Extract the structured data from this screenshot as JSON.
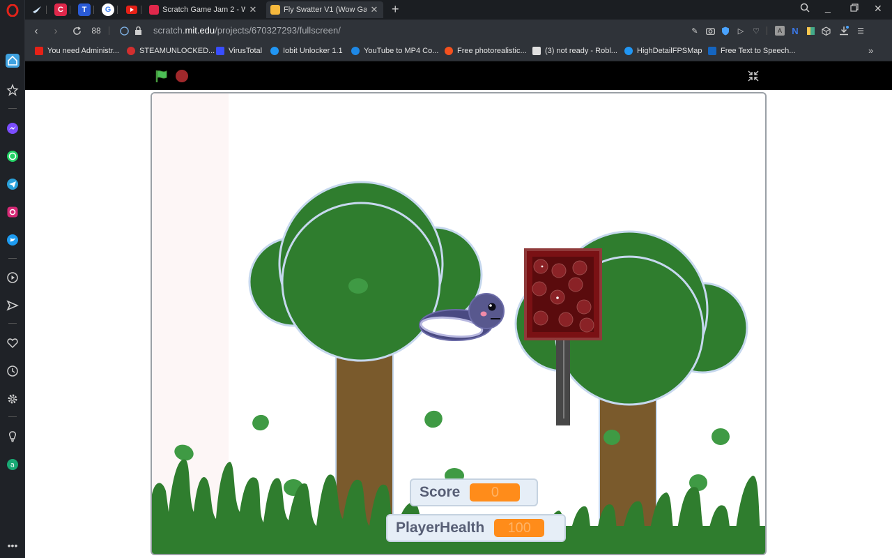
{
  "tabs": [
    {
      "title": "Scratch Game Jam 2 - Wow",
      "active": false
    },
    {
      "title": "Fly Swatter V1 (Wow Game",
      "active": true
    }
  ],
  "url": {
    "prefix": "scratch.",
    "domain": "mit.edu",
    "path": "/projects/670327293/fullscreen/"
  },
  "bookmarks": [
    {
      "label": "You need Administr...",
      "color": "#e62117"
    },
    {
      "label": "STEAMUNLOCKED...",
      "color": "#d32f2f"
    },
    {
      "label": "VirusTotal",
      "color": "#394eff"
    },
    {
      "label": "Iobit Unlocker 1.1",
      "color": "#2196f3"
    },
    {
      "label": "YouTube to MP4 Co...",
      "color": "#1e88e5"
    },
    {
      "label": "Free photorealistic...",
      "color": "#f4511e"
    },
    {
      "label": "(3) not ready - Robl...",
      "color": "#e0e0e0"
    },
    {
      "label": "HighDetailFPSMap",
      "color": "#2196f3"
    },
    {
      "label": "Free Text to Speech...",
      "color": "#1565c0"
    }
  ],
  "monitors": {
    "score": {
      "label": "Score",
      "value": "0"
    },
    "health": {
      "label": "PlayerHealth",
      "value": "100"
    }
  },
  "colors": {
    "opera": "#e2231a",
    "foliage": "#2f7d2e",
    "trunk": "#7a5a2c",
    "board": "#7a1114"
  }
}
